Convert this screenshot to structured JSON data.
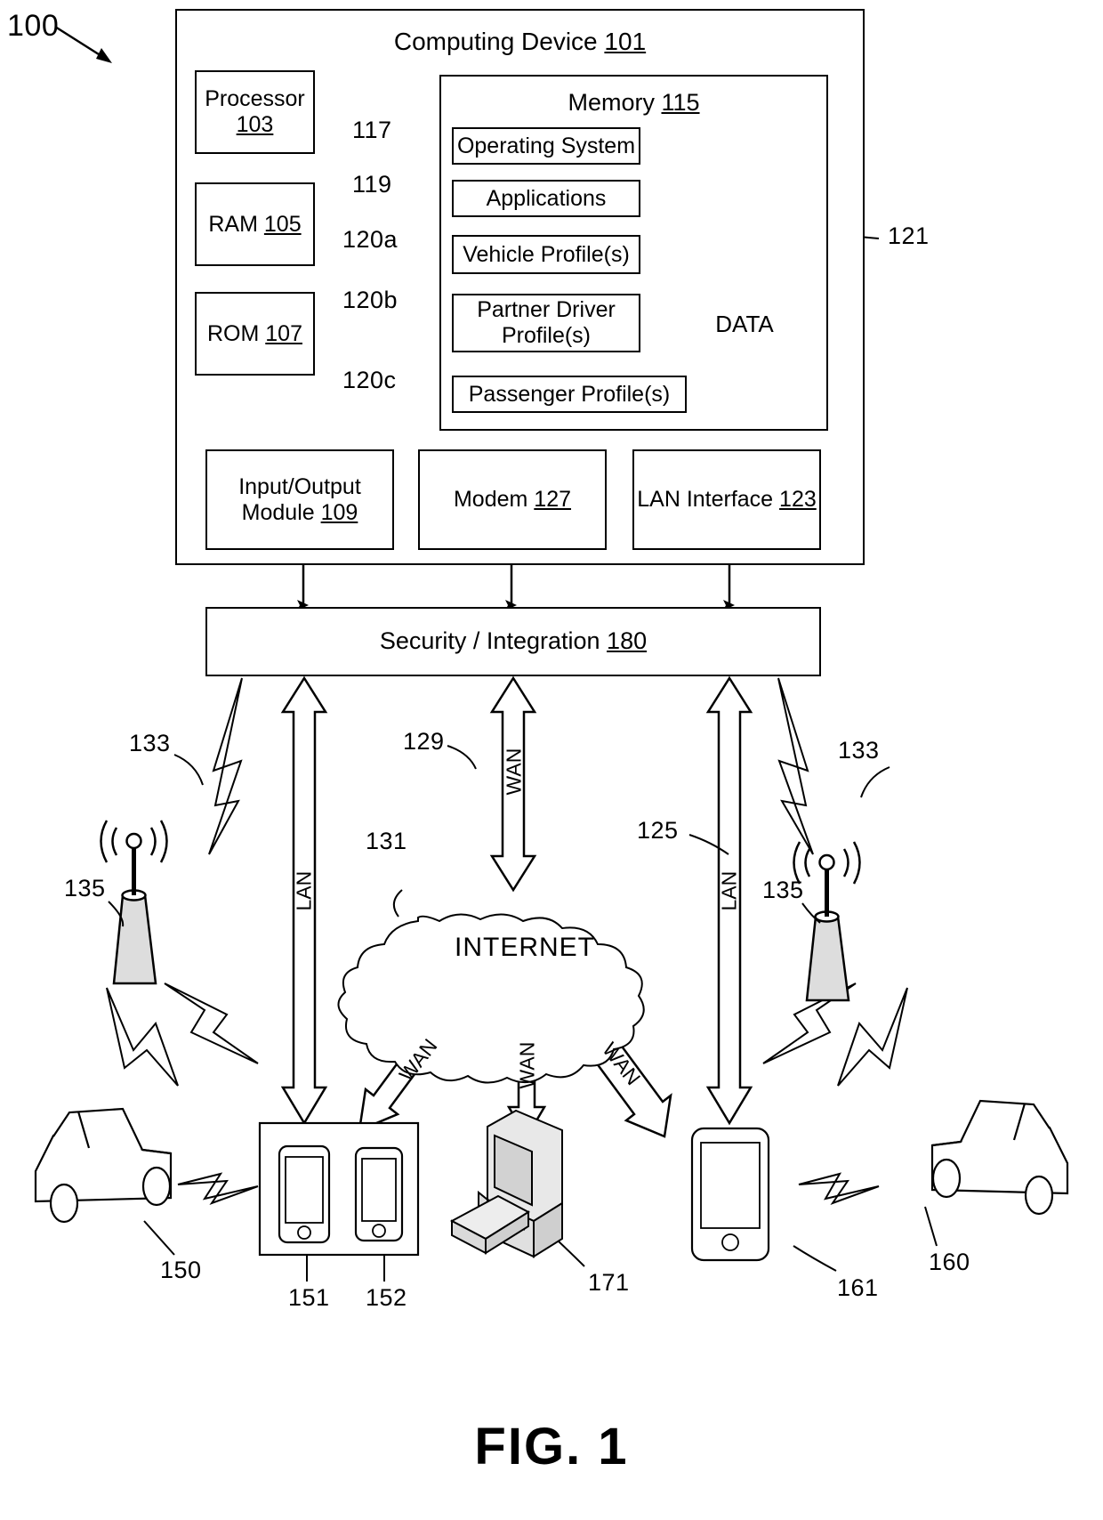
{
  "figure": {
    "caption": "FIG. 1",
    "system_ref": "100"
  },
  "computing_device": {
    "title": "Computing Device",
    "ref": "101",
    "processor": {
      "label": "Processor",
      "ref": "103"
    },
    "ram": {
      "label": "RAM",
      "ref": "105"
    },
    "rom": {
      "label": "ROM",
      "ref": "107"
    },
    "memory": {
      "title": "Memory",
      "ref": "115",
      "items": [
        {
          "ref": "117",
          "label": "Operating System"
        },
        {
          "ref": "119",
          "label": "Applications"
        },
        {
          "ref": "120a",
          "label": "Vehicle Profile(s)"
        },
        {
          "ref": "120b",
          "label": "Partner Driver Profile(s)"
        },
        {
          "ref": "120c",
          "label": "Passenger Profile(s)"
        }
      ],
      "database": {
        "label": "DATA",
        "ref": "121"
      }
    },
    "io_module": {
      "label": "Input/Output Module",
      "ref": "109"
    },
    "modem": {
      "label": "Modem",
      "ref": "127"
    },
    "lan_interface": {
      "label": "LAN Interface",
      "ref": "123"
    }
  },
  "security": {
    "label": "Security / Integration",
    "ref": "180"
  },
  "network": {
    "internet": {
      "label": "INTERNET",
      "ref": "131"
    },
    "lan_left": {
      "label": "LAN"
    },
    "lan_right": {
      "label": "LAN",
      "ref": "125"
    },
    "wan_center": {
      "label": "WAN",
      "ref": "129"
    },
    "wan_internet_left": {
      "label": "WAN"
    },
    "wan_internet_center": {
      "label": "WAN"
    },
    "wan_internet_right": {
      "label": "WAN"
    },
    "wireless_link_left": {
      "ref": "133"
    },
    "wireless_link_right": {
      "ref": "133"
    },
    "tower_left": {
      "ref": "135"
    },
    "tower_right": {
      "ref": "135"
    }
  },
  "endpoints": [
    {
      "ref": "150",
      "name": "vehicle-left"
    },
    {
      "ref": "151",
      "name": "mobile-device-1"
    },
    {
      "ref": "152",
      "name": "mobile-device-2"
    },
    {
      "ref": "171",
      "name": "desktop-computer"
    },
    {
      "ref": "161",
      "name": "mobile-device-3"
    },
    {
      "ref": "160",
      "name": "vehicle-right"
    }
  ]
}
